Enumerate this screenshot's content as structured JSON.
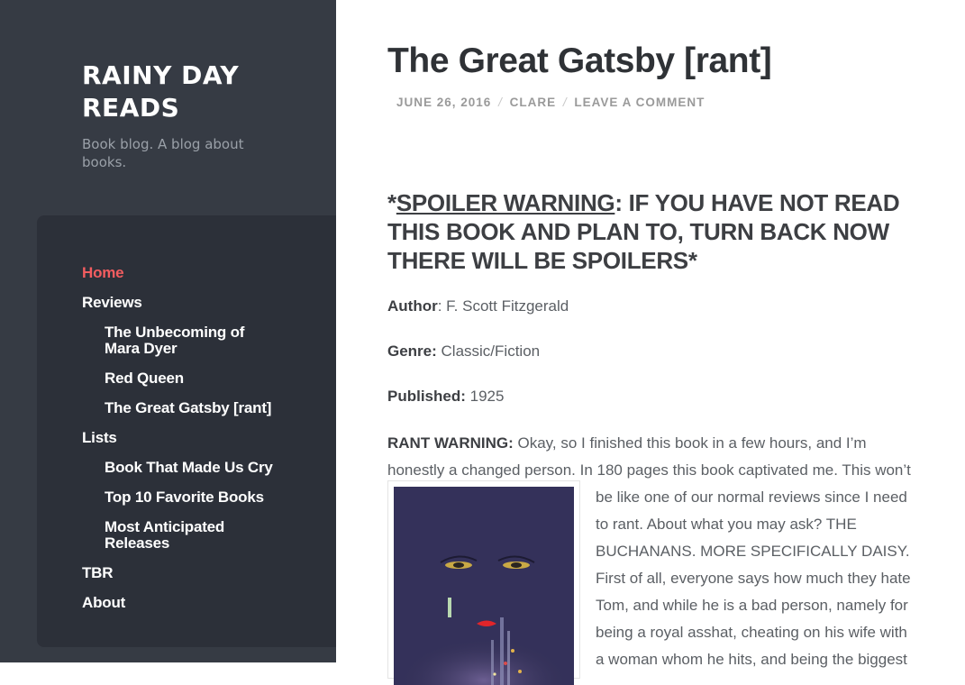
{
  "site": {
    "title": "RAINY DAY READS",
    "description": "Book blog. A blog about books."
  },
  "menu": [
    {
      "label": "Home",
      "level": 0,
      "active": true
    },
    {
      "label": "Reviews",
      "level": 0
    },
    {
      "label": "The Unbecoming of Mara Dyer",
      "level": 1
    },
    {
      "label": "Red Queen",
      "level": 1
    },
    {
      "label": "The Great Gatsby [rant]",
      "level": 1
    },
    {
      "label": "Lists",
      "level": 0
    },
    {
      "label": "Book That Made Us Cry",
      "level": 1
    },
    {
      "label": "Top 10 Favorite Books",
      "level": 1
    },
    {
      "label": "Most Anticipated Releases",
      "level": 1
    },
    {
      "label": "TBR",
      "level": 0
    },
    {
      "label": "About",
      "level": 0
    }
  ],
  "post": {
    "title": "The Great Gatsby [rant]",
    "meta": {
      "date": "JUNE 26, 2016",
      "author": "CLARE",
      "comments": "LEAVE A COMMENT",
      "separator": "/"
    },
    "spoiler": {
      "prefix": "*",
      "underlined": "SPOILER WARNING",
      "rest": ": IF YOU HAVE NOT READ THIS BOOK AND PLAN TO, TURN BACK NOW THERE WILL BE SPOILERS*"
    },
    "facts": {
      "author_label": "Author",
      "author_value": ": F. Scott Fitzgerald",
      "genre_label": "Genre:",
      "genre_value": " Classic/Fiction",
      "published_label": "Published:",
      "published_value": " 1925"
    },
    "rant": {
      "label": "RANT WARNING:",
      "line1": " Okay, so I finished this book in a few hours, and I’m",
      "line2": "honestly a changed person. In 180 pages this book captivated me. This won’t",
      "wrap_lines": [
        "be like one of our normal reviews since I need",
        "to rant. About what you may ask? THE",
        "BUCHANANS. MORE SPECIFICALLY DAISY.",
        "First of all, everyone says how much they hate",
        "Tom, and while he is a bad person, namely for",
        "being a royal asshat, cheating on his wife with",
        "a woman whom he hits, and being the biggest"
      ]
    }
  },
  "colors": {
    "sidebar_bg": "#363b44",
    "menu_panel_bg": "#2c3039",
    "active_link": "#f35d60"
  }
}
